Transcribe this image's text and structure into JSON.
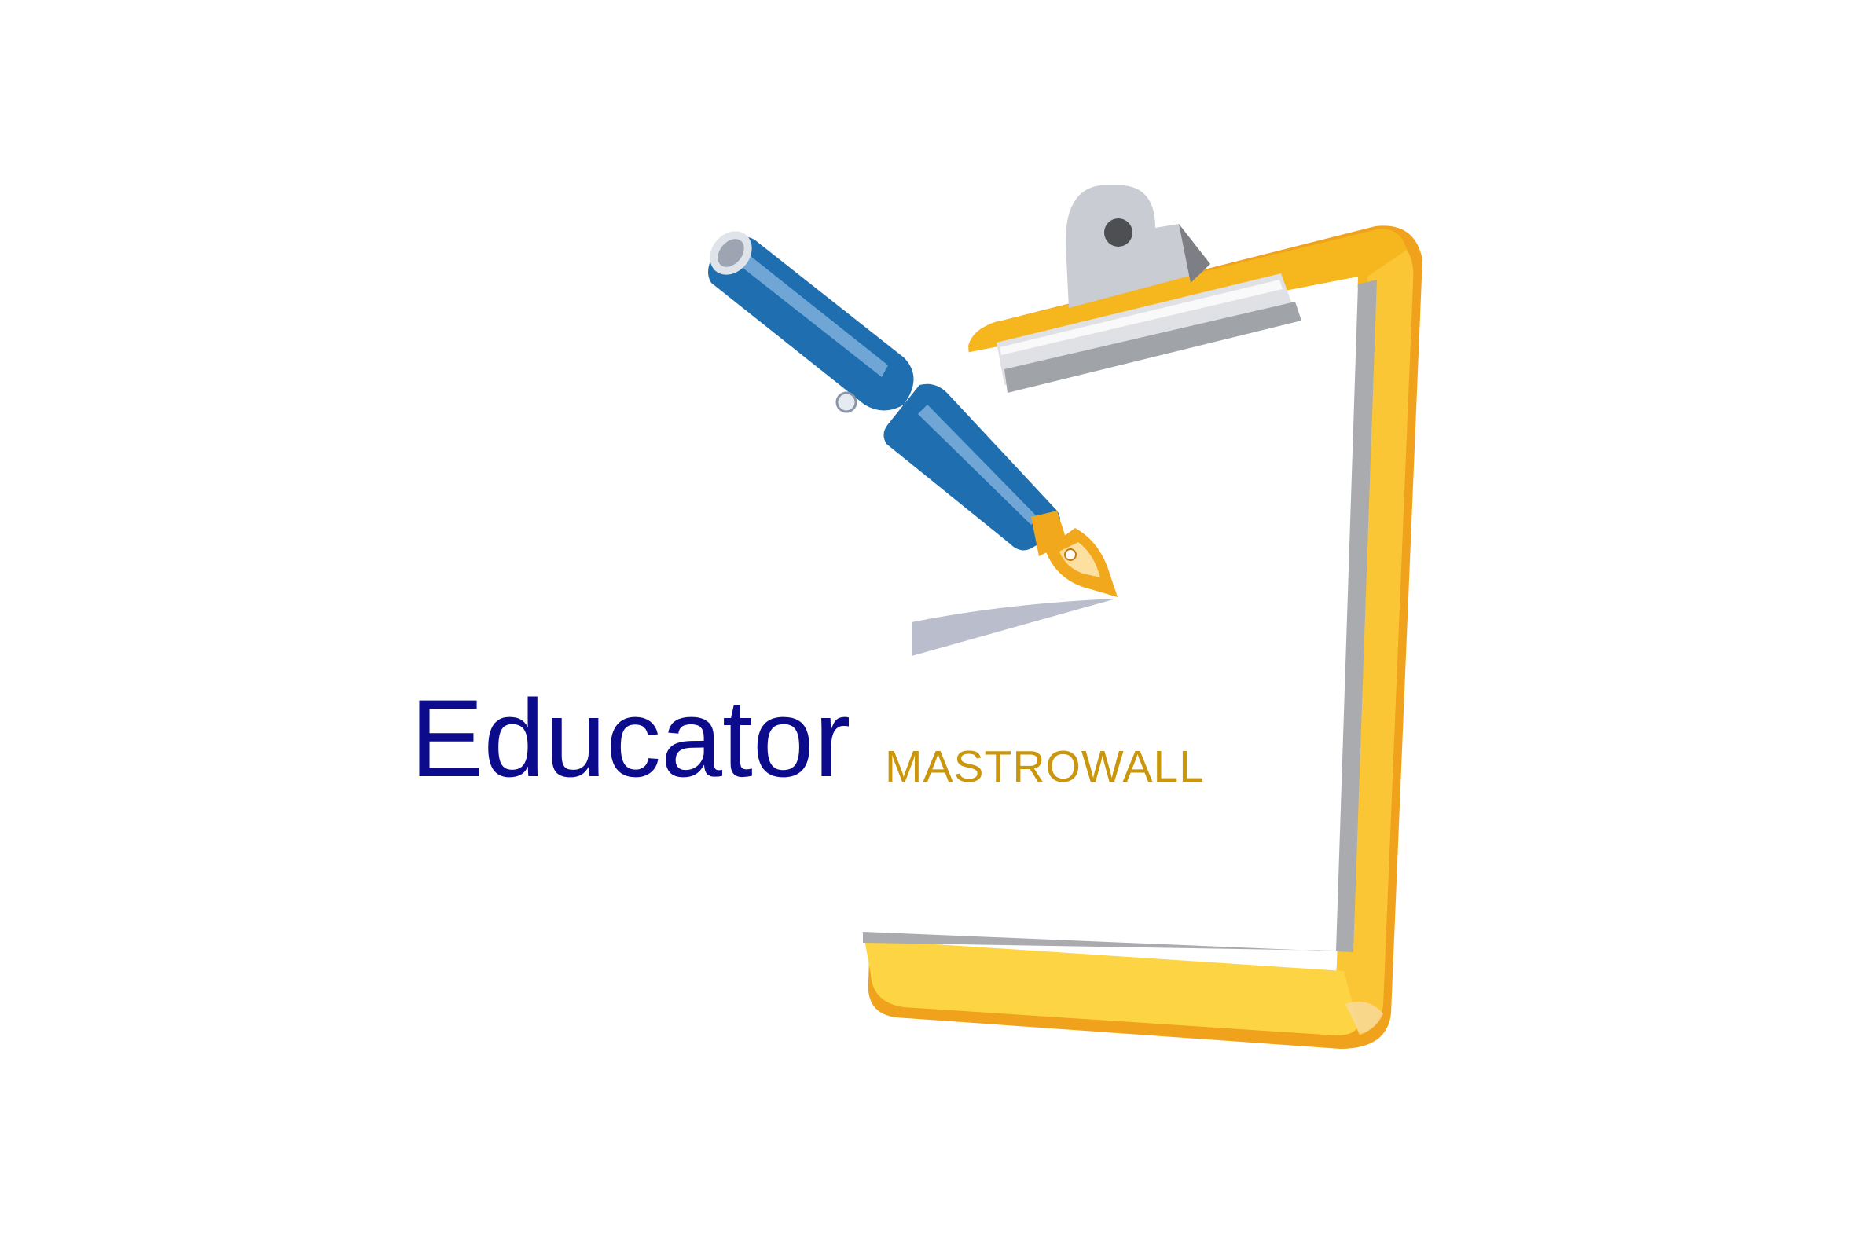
{
  "logo": {
    "name": "Educator",
    "tagline": "MASTROWALL",
    "icons": [
      "clipboard-icon",
      "fountain-pen-icon"
    ],
    "colors": {
      "name_text": "#0b0b8c",
      "tagline_text": "#c9960c",
      "clipboard_board": "#f5b21a",
      "clipboard_board_light": "#fdd444",
      "clip_metal": "#c9ccd2",
      "pen_barrel": "#1f6fb0",
      "pen_nib": "#f2a81c"
    }
  }
}
